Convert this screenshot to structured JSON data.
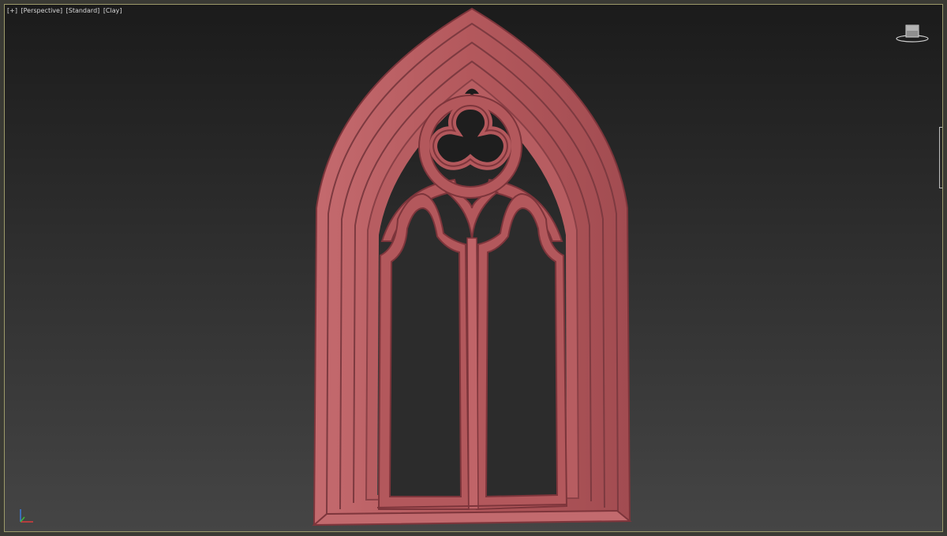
{
  "viewport": {
    "labels": [
      "[+]",
      "[Perspective]",
      "[Standard]",
      "[Clay]"
    ]
  },
  "scene": {
    "object": "gothic-window-model",
    "material_color": "#b3585c",
    "material_shadow": "#8a3e44",
    "material_highlight": "#cc7276",
    "background_top": "#1b1b1b",
    "background_bottom": "#454545",
    "viewport_border": "#9c9a6a"
  },
  "icons": {
    "view_cube": "view-cube-icon",
    "axis": "axis-tripod-icon"
  }
}
